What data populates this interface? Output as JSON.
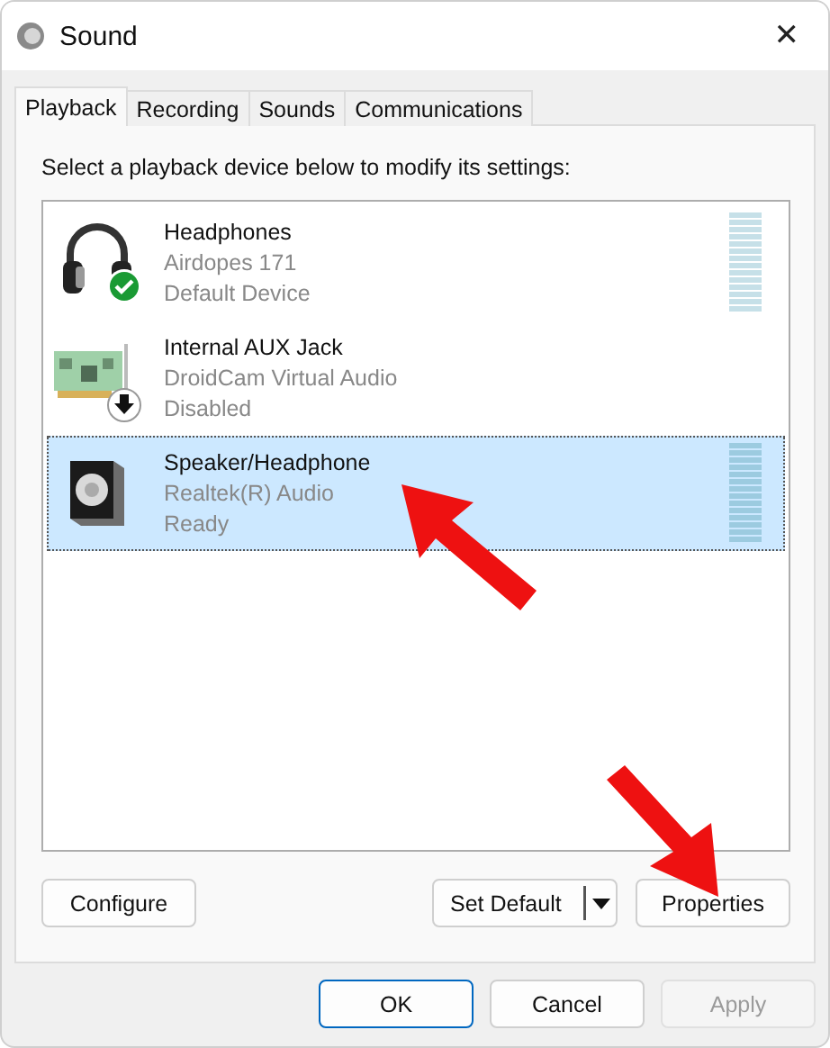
{
  "window": {
    "title": "Sound",
    "close": "✕"
  },
  "tabs": [
    {
      "label": "Playback",
      "selected": true
    },
    {
      "label": "Recording",
      "selected": false
    },
    {
      "label": "Sounds",
      "selected": false
    },
    {
      "label": "Communications",
      "selected": false
    }
  ],
  "instruction": "Select a playback device below to modify its settings:",
  "devices": [
    {
      "kind": "headphones",
      "default": true,
      "disabled": false,
      "name": "Headphones",
      "driver": "Airdopes 171",
      "state": "Default Device",
      "meter": true,
      "selected": false
    },
    {
      "kind": "card",
      "default": false,
      "disabled": true,
      "name": "Internal AUX Jack",
      "driver": "DroidCam Virtual Audio",
      "state": "Disabled",
      "meter": false,
      "selected": false
    },
    {
      "kind": "speaker",
      "default": false,
      "disabled": false,
      "name": "Speaker/Headphone",
      "driver": "Realtek(R) Audio",
      "state": "Ready",
      "meter": true,
      "selected": true
    }
  ],
  "panel_buttons": {
    "configure": "Configure",
    "set_default": "Set Default",
    "properties": "Properties"
  },
  "footer_buttons": [
    {
      "label": "OK",
      "default": true,
      "disabled": false
    },
    {
      "label": "Cancel",
      "default": false,
      "disabled": false
    },
    {
      "label": "Apply",
      "default": false,
      "disabled": true
    }
  ]
}
